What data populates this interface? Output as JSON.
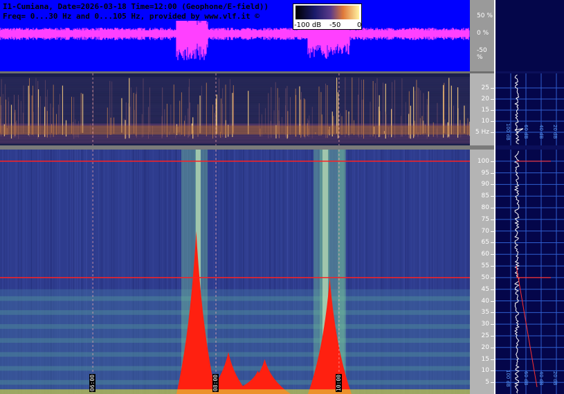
{
  "header": {
    "line1": "I1-Cumiana, Date=2026-03-18 Time=12:00 (Geophone/E-field))",
    "line2": "Freq= 0...30 Hz and 0...105 Hz, provided by www.vlf.it ©"
  },
  "scale": {
    "labels": [
      "-100 dB",
      "-50",
      "0"
    ]
  },
  "chart_data": [
    {
      "type": "line",
      "name": "waveform",
      "y_ticks": [
        "50 %",
        "0 %",
        "-50 %"
      ],
      "y_values": [
        50,
        0,
        -50
      ],
      "ylim": [
        -100,
        100
      ]
    },
    {
      "type": "heatmap",
      "name": "spectrogram-low",
      "y_ticks": [
        "25",
        "20",
        "15",
        "10",
        "5 Hz"
      ],
      "y_values": [
        25,
        20,
        15,
        10,
        5
      ],
      "ylim": [
        0,
        30
      ]
    },
    {
      "type": "heatmap",
      "name": "spectrogram-main",
      "y_ticks": [
        "100",
        "95",
        "90",
        "85",
        "80",
        "75",
        "70",
        "65",
        "60",
        "55",
        "50",
        "45",
        "40",
        "35",
        "30",
        "25",
        "20",
        "15",
        "10",
        "5"
      ],
      "y_values": [
        100,
        95,
        90,
        85,
        80,
        75,
        70,
        65,
        60,
        55,
        50,
        45,
        40,
        35,
        30,
        25,
        20,
        15,
        10,
        5
      ],
      "ylim": [
        0,
        105
      ],
      "time_labels": [
        "06:00",
        "08:00",
        "10:00"
      ],
      "time_positions_fraction": [
        0.199,
        0.461,
        0.723
      ]
    }
  ],
  "profile": {
    "low_labels": [
      "100 dB",
      "60 dB",
      "40 dB",
      "20 dB"
    ],
    "main_labels": [
      "100 dB",
      "60 dB",
      "40 dB",
      "20 dB"
    ]
  },
  "colors": {
    "wave_bg": "#0000ff",
    "wave_trace": "#ff40ff",
    "axis_bg": "#b4b4b4",
    "red_line": "#ff2020"
  }
}
